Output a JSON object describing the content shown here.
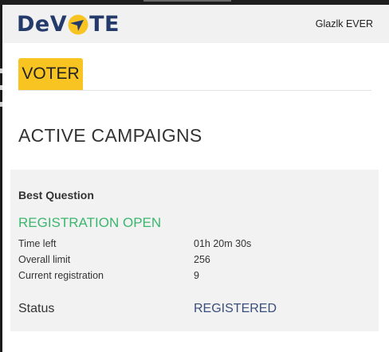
{
  "app": {
    "logo_prefix": "DeV",
    "logo_suffix": "TE",
    "logo_color": "#233a6b",
    "logo_accent": "#f8c421",
    "user_name": "Glazlk EVER"
  },
  "role_tab": {
    "label": "VOTER",
    "color": "#f8c421"
  },
  "section_title": "ACTIVE CAMPAIGNS",
  "campaign": {
    "question": "Best Question",
    "registration_state": "REGISTRATION OPEN",
    "registration_state_color": "#3bb66e",
    "fields": [
      {
        "label": "Time left",
        "value": "01h 20m 30s"
      },
      {
        "label": "Overall limit",
        "value": "256"
      },
      {
        "label": "Current registration",
        "value": "9"
      }
    ],
    "status_label": "Status",
    "status_value": "REGISTERED"
  }
}
